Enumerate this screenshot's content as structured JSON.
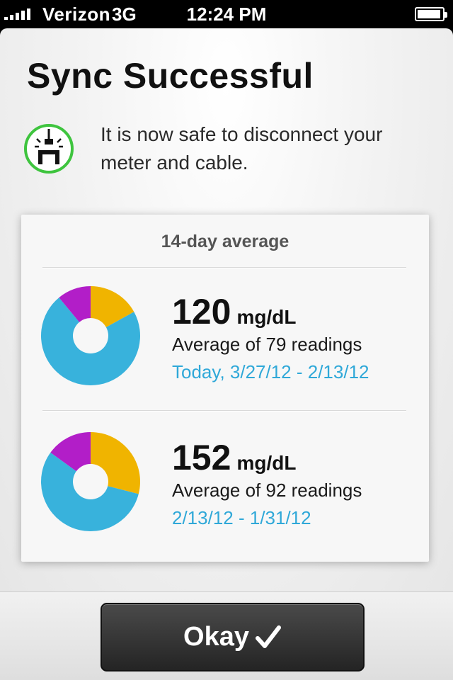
{
  "status_bar": {
    "carrier": "Verizon",
    "network": "3G",
    "time": "12:24 PM",
    "battery_level": 0.95,
    "signal_bars": 5
  },
  "header": {
    "title": "Sync Successful",
    "icon": "plug-disconnect-icon",
    "message": "It is now safe to disconnect your meter and cable."
  },
  "summary": {
    "title": "14-day average",
    "readings": [
      {
        "value": "120",
        "unit": "mg/dL",
        "count_text": "Average of 79 readings",
        "range": "Today, 3/27/12 - 2/13/12",
        "distribution": [
          {
            "name": "high",
            "fraction": 0.17,
            "color": "#f0b400"
          },
          {
            "name": "in-range",
            "fraction": 0.72,
            "color": "#38b2dc"
          },
          {
            "name": "low",
            "fraction": 0.11,
            "color": "#b21ec8"
          }
        ]
      },
      {
        "value": "152",
        "unit": "mg/dL",
        "count_text": "Average of 92 readings",
        "range": "2/13/12 - 1/31/12",
        "distribution": [
          {
            "name": "high",
            "fraction": 0.29,
            "color": "#f0b400"
          },
          {
            "name": "in-range",
            "fraction": 0.56,
            "color": "#38b2dc"
          },
          {
            "name": "low",
            "fraction": 0.15,
            "color": "#b21ec8"
          }
        ]
      }
    ]
  },
  "footer": {
    "button_label": "Okay",
    "button_icon": "checkmark-icon"
  },
  "colors": {
    "accent_blue": "#2fa8d8",
    "success_green": "#3ec43e"
  }
}
